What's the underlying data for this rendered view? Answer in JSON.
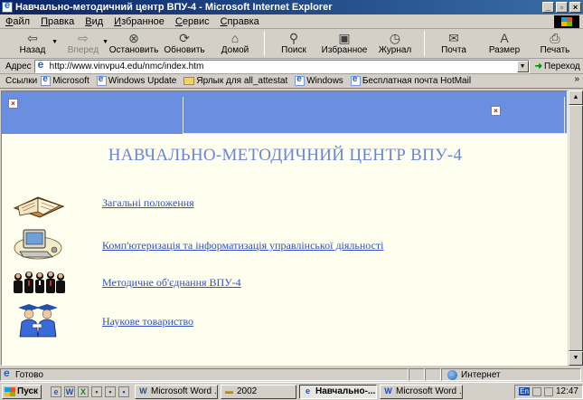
{
  "window": {
    "title": "Навчально-методичний центр ВПУ-4 - Microsoft Internet Explorer"
  },
  "menu": [
    "Файл",
    "Правка",
    "Вид",
    "Избранное",
    "Сервис",
    "Справка"
  ],
  "toolbar": {
    "back": "Назад",
    "forward": "Вперед",
    "stop": "Остановить",
    "refresh": "Обновить",
    "home": "Домой",
    "search": "Поиск",
    "favorites": "Избранное",
    "history": "Журнал",
    "mail": "Почта",
    "size": "Размер",
    "print": "Печать"
  },
  "address": {
    "label": "Адрес",
    "url": "http://www.vinvpu4.edu/nmc/index.htm",
    "go": "Переход"
  },
  "links": {
    "label": "Ссылки",
    "items": [
      "Microsoft",
      "Windows Update",
      "Ярлык для all_attestat",
      "Windows",
      "Бесплатная почта HotMail"
    ]
  },
  "page": {
    "title": "НАВЧАЛЬНО-МЕТОДИЧНИЙ ЦЕНТР ВПУ-4",
    "items": [
      {
        "text": "Загальні положення",
        "icon": "open-book-icon"
      },
      {
        "text": "Комп'ютеризація та інформатизація управлінської діяльності",
        "icon": "computer-icon"
      },
      {
        "text": "Методичне об'єднання ВПУ-4",
        "icon": "people-group-icon"
      },
      {
        "text": "Наукове товариство",
        "icon": "graduates-icon"
      }
    ]
  },
  "status": {
    "text": "Готово",
    "zone": "Интернет"
  },
  "taskbar": {
    "start": "Пуск",
    "tasks": [
      "Microsoft Word ...",
      "2002",
      "Навчально-...",
      "Microsoft Word ..."
    ],
    "lang": "En",
    "clock": "12:47"
  },
  "colors": {
    "banner": "#6b8fe0",
    "title": "#6a85d6",
    "link": "#3050c0",
    "background": "#fffff0"
  }
}
